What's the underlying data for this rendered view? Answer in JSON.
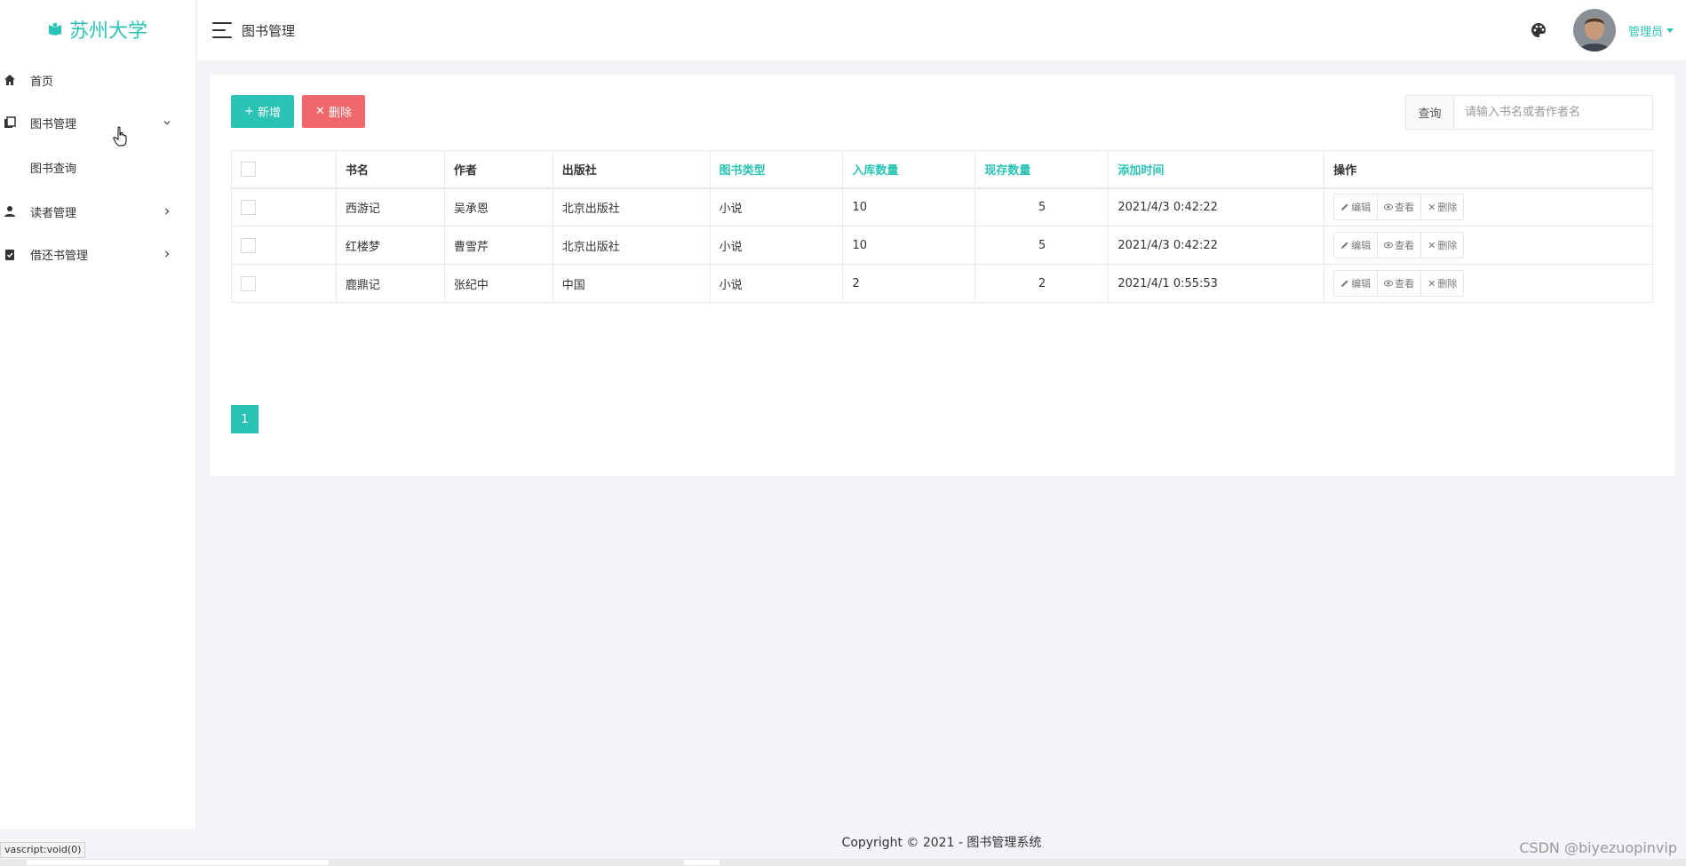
{
  "brand": {
    "name": "苏州大学"
  },
  "sidebar": {
    "items": [
      {
        "label": "首页"
      },
      {
        "label": "图书管理"
      },
      {
        "label": "读者管理"
      },
      {
        "label": "借还书管理"
      }
    ],
    "submenu": {
      "label": "图书查询"
    }
  },
  "topbar": {
    "title": "图书管理",
    "user": "管理员"
  },
  "toolbar": {
    "add_label": "新增",
    "delete_label": "删除"
  },
  "search": {
    "label": "查询",
    "placeholder": "请输入书名或者作者名"
  },
  "table": {
    "headers": [
      "书名",
      "作者",
      "出版社",
      "图书类型",
      "入库数量",
      "现存数量",
      "添加时间",
      "操作"
    ],
    "rows": [
      {
        "name": "西游记",
        "author": "吴承恩",
        "publisher": "北京出版社",
        "type": "小说",
        "in_qty": "10",
        "stock": "5",
        "added": "2021/4/3 0:42:22"
      },
      {
        "name": "红楼梦",
        "author": "曹雪芹",
        "publisher": "北京出版社",
        "type": "小说",
        "in_qty": "10",
        "stock": "5",
        "added": "2021/4/3 0:42:22"
      },
      {
        "name": "鹿鼎记",
        "author": "张纪中",
        "publisher": "中国",
        "type": "小说",
        "in_qty": "2",
        "stock": "2",
        "added": "2021/4/1 0:55:53"
      }
    ],
    "row_actions": {
      "edit": "编辑",
      "view": "查看",
      "delete": "删除"
    }
  },
  "pagination": {
    "current": "1"
  },
  "footer": {
    "copyright": "Copyright © 2021 - 图书管理系统"
  },
  "statusbar": {
    "text": "vascript:void(0)"
  },
  "watermark": "CSDN @biyezuopinvip",
  "colors": {
    "accent": "#2bc3b5",
    "danger": "#f0686b"
  }
}
